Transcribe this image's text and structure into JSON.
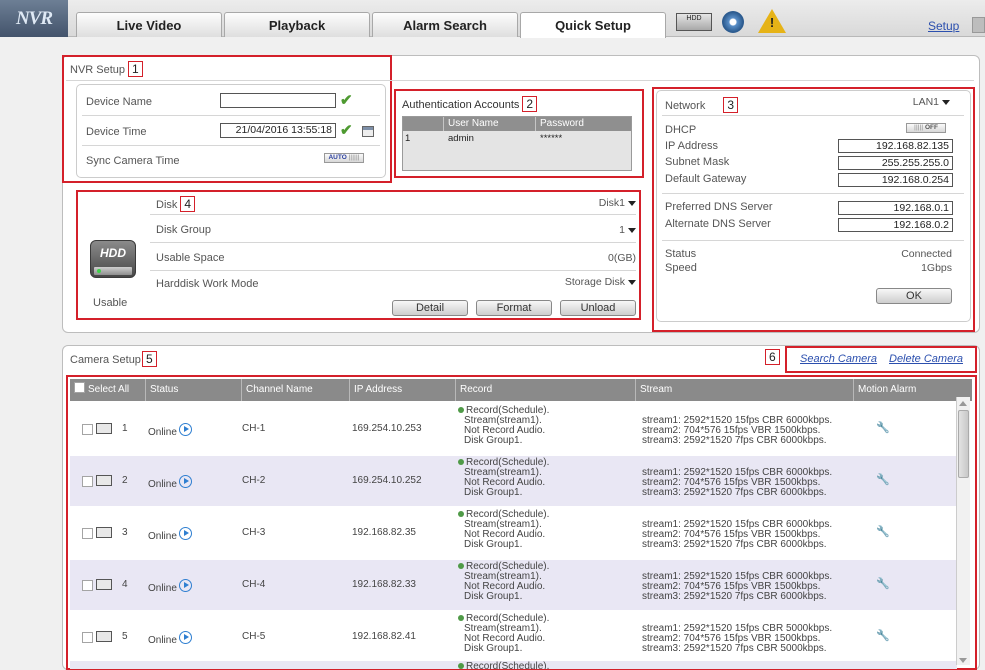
{
  "nav": {
    "logo": "NVR",
    "tabs": [
      "Live Video",
      "Playback",
      "Alarm Search",
      "Quick Setup"
    ],
    "active_tab": "Quick Setup",
    "hdd_icon_text": "HDD",
    "warn_mark": "!",
    "setup_link": "Setup"
  },
  "nvr_setup": {
    "title": "NVR Setup",
    "marker": "1",
    "device_name_label": "Device Name",
    "device_name_value": "",
    "device_time_label": "Device Time",
    "device_time_value": "21/04/2016 13:55:18",
    "sync_label": "Sync Camera Time",
    "sync_toggle": "AUTO"
  },
  "auth": {
    "title": "Authentication Accounts",
    "marker": "2",
    "headers": [
      "User Name",
      "Password"
    ],
    "rows": [
      {
        "index": "1",
        "user": "admin",
        "password": "******"
      }
    ]
  },
  "network": {
    "title": "Network",
    "marker": "3",
    "interface": "LAN1",
    "dhcp_label": "DHCP",
    "dhcp_toggle": "OFF",
    "ip_label": "IP Address",
    "ip_value": "192.168.82.135",
    "mask_label": "Subnet Mask",
    "mask_value": "255.255.255.0",
    "gateway_label": "Default Gateway",
    "gateway_value": "192.168.0.254",
    "pdns_label": "Preferred DNS Server",
    "pdns_value": "192.168.0.1",
    "adns_label": "Alternate DNS Server",
    "adns_value": "192.168.0.2",
    "status_label": "Status",
    "status_value": "Connected",
    "speed_label": "Speed",
    "speed_value": "1Gbps",
    "ok_button": "OK"
  },
  "disk": {
    "marker": "4",
    "icon_text": "HDD",
    "state": "Usable",
    "disk_label": "Disk",
    "disk_value": "Disk1",
    "group_label": "Disk Group",
    "group_value": "1",
    "space_label": "Usable Space",
    "space_value": "0(GB)",
    "mode_label": "Harddisk Work Mode",
    "mode_value": "Storage Disk",
    "buttons": [
      "Detail",
      "Format",
      "Unload"
    ]
  },
  "camera_setup": {
    "title": "Camera Setup",
    "marker": "5",
    "links_marker": "6",
    "search_link": "Search Camera",
    "delete_link": "Delete Camera",
    "headers": [
      "Select All",
      "Status",
      "Channel Name",
      "IP Address",
      "Record",
      "Stream",
      "Motion Alarm"
    ],
    "rows": [
      {
        "num": "1",
        "status": "Online",
        "channel": "CH-1",
        "ip": "169.254.10.253",
        "record": [
          "Record(Schedule).",
          "Stream(stream1).",
          "Not Record Audio.",
          "Disk Group1."
        ],
        "stream": [
          "stream1: 2592*1520 15fps CBR 6000kbps.",
          "stream2: 704*576 15fps VBR 1500kbps.",
          "stream3: 2592*1520 7fps CBR 6000kbps."
        ]
      },
      {
        "num": "2",
        "status": "Online",
        "channel": "CH-2",
        "ip": "169.254.10.252",
        "record": [
          "Record(Schedule).",
          "Stream(stream1).",
          "Not Record Audio.",
          "Disk Group1."
        ],
        "stream": [
          "stream1: 2592*1520 15fps CBR 6000kbps.",
          "stream2: 704*576 15fps VBR 1500kbps.",
          "stream3: 2592*1520 7fps CBR 6000kbps."
        ]
      },
      {
        "num": "3",
        "status": "Online",
        "channel": "CH-3",
        "ip": "192.168.82.35",
        "record": [
          "Record(Schedule).",
          "Stream(stream1).",
          "Not Record Audio.",
          "Disk Group1."
        ],
        "stream": [
          "stream1: 2592*1520 15fps CBR 6000kbps.",
          "stream2: 704*576 15fps VBR 1500kbps.",
          "stream3: 2592*1520 7fps CBR 6000kbps."
        ]
      },
      {
        "num": "4",
        "status": "Online",
        "channel": "CH-4",
        "ip": "192.168.82.33",
        "record": [
          "Record(Schedule).",
          "Stream(stream1).",
          "Not Record Audio.",
          "Disk Group1."
        ],
        "stream": [
          "stream1: 2592*1520 15fps CBR 6000kbps.",
          "stream2: 704*576 15fps VBR 1500kbps.",
          "stream3: 2592*1520 7fps CBR 6000kbps."
        ]
      },
      {
        "num": "5",
        "status": "Online",
        "channel": "CH-5",
        "ip": "192.168.82.41",
        "record": [
          "Record(Schedule).",
          "Stream(stream1).",
          "Not Record Audio.",
          "Disk Group1."
        ],
        "stream": [
          "stream1: 2592*1520 15fps CBR 5000kbps.",
          "stream2: 704*576 15fps VBR 1500kbps.",
          "stream3: 2592*1520 7fps CBR 5000kbps."
        ]
      }
    ],
    "partial_row_text": "Record(Schedule)."
  }
}
